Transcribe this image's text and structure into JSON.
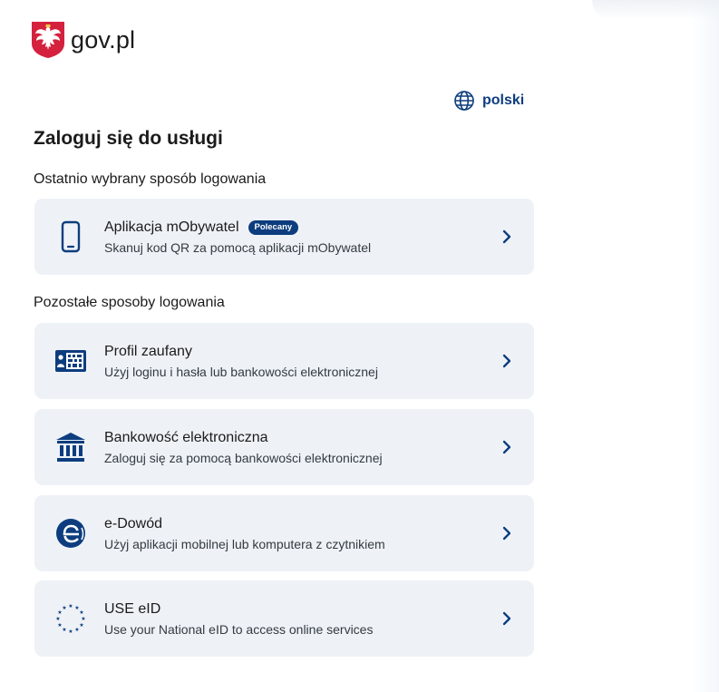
{
  "header": {
    "logo_text": "gov.pl",
    "language_label": "polski"
  },
  "page": {
    "title": "Zaloguj się do usługi",
    "recent_section_label": "Ostatnio wybrany sposób logowania",
    "other_section_label": "Pozostałe sposoby logowania"
  },
  "methods": [
    {
      "title": "Aplikacja mObywatel",
      "badge": "Polecany",
      "description": "Skanuj kod QR za pomocą aplikacji mObywatel",
      "icon": "phone-icon"
    },
    {
      "title": "Profil zaufany",
      "description": "Użyj loginu i hasła lub bankowości elektronicznej",
      "icon": "trusted-profile-icon"
    },
    {
      "title": "Bankowość elektroniczna",
      "description": "Zaloguj się za pomocą bankowości elektronicznej",
      "icon": "bank-icon"
    },
    {
      "title": "e-Dowód",
      "description": "Użyj aplikacji mobilnej lub komputera z czytnikiem",
      "icon": "e-id-card-icon"
    },
    {
      "title": "USE eID",
      "description": "Use your National eID to access online services",
      "icon": "eu-stars-icon"
    }
  ],
  "colors": {
    "accent": "#0d3d7e",
    "card_background": "#eef2f7",
    "badge_background": "#0d3d7e",
    "emblem_red": "#d4213d"
  }
}
